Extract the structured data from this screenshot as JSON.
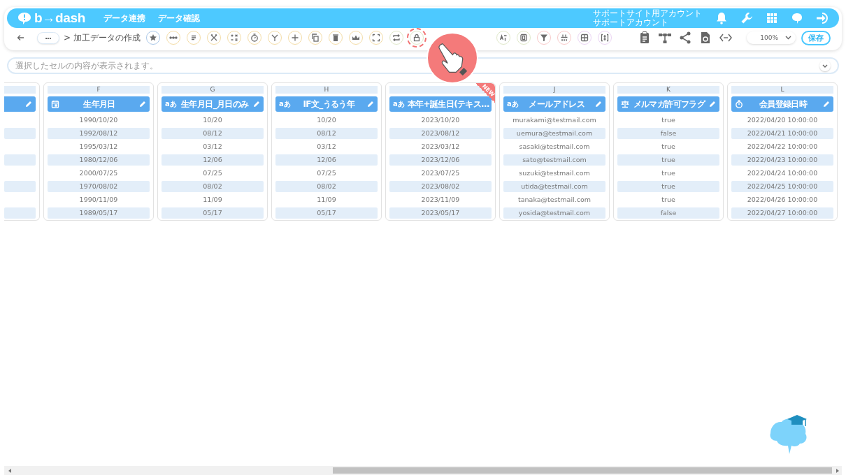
{
  "header": {
    "logo": "b→dash",
    "nav": [
      {
        "label": "データ連携"
      },
      {
        "label": "データ確認"
      }
    ],
    "account": {
      "site": "サポートサイト用アカウント",
      "name": "サポートアカウント"
    },
    "icons": [
      {
        "kind": "bell"
      },
      {
        "kind": "wrench"
      },
      {
        "kind": "apps"
      },
      {
        "kind": "assistant"
      },
      {
        "kind": "logout"
      }
    ]
  },
  "toolbar": {
    "more": "•••",
    "breadcrumb": "> 加工データの作成",
    "tool_groups": [
      [
        {
          "kind": "star",
          "color": "#a9c7e8",
          "highlighted": false
        },
        {
          "kind": "dots",
          "color": "#f3dca6",
          "highlighted": false
        },
        {
          "kind": "lines",
          "color": "#f3dca6",
          "highlighted": false
        },
        {
          "kind": "scissors",
          "color": "#f3dca6",
          "highlighted": false
        },
        {
          "kind": "math",
          "color": "#f3dca6",
          "highlighted": false
        },
        {
          "kind": "timer",
          "color": "#f3dca6",
          "highlighted": false
        },
        {
          "kind": "branch",
          "color": "#f3dca6",
          "highlighted": false
        },
        {
          "kind": "plus",
          "color": "#f3dca6",
          "highlighted": false
        },
        {
          "kind": "copy",
          "color": "#f3dca6",
          "highlighted": false
        },
        {
          "kind": "trash",
          "color": "#f3dca6",
          "highlighted": false
        },
        {
          "kind": "crown",
          "color": "#f3dca6",
          "highlighted": false
        },
        {
          "kind": "expand",
          "color": "#f3dca6",
          "highlighted": false
        },
        {
          "kind": "swap",
          "color": "#dfe8c9",
          "highlighted": false
        },
        {
          "kind": "lock",
          "color": "#dfe8c9",
          "highlighted": true
        }
      ],
      [
        {
          "kind": "translate",
          "color": "#dfe8c9",
          "highlighted": false
        },
        {
          "kind": "zero",
          "color": "#dfe8c9",
          "highlighted": false
        },
        {
          "kind": "filter",
          "color": "#f8c9c9",
          "highlighted": false
        },
        {
          "kind": "group",
          "color": "#f8c9c9",
          "highlighted": false
        },
        {
          "kind": "grid",
          "color": "#ead3f3",
          "highlighted": false
        },
        {
          "kind": "bracket",
          "color": "#ead3f3",
          "highlighted": false
        }
      ]
    ],
    "actions": [
      {
        "kind": "clipboard"
      },
      {
        "kind": "hierarchy"
      },
      {
        "kind": "share"
      },
      {
        "kind": "restore"
      },
      {
        "kind": "code"
      }
    ],
    "zoom": "100%",
    "save": "保存"
  },
  "formula_bar": {
    "placeholder": "選択したセルの内容が表示されます。"
  },
  "columns": [
    {
      "kind": "partial"
    },
    {
      "kind": "date",
      "letter": "F",
      "title": "生年月日",
      "cells": [
        "1990/10/20",
        "1992/08/12",
        "1995/03/12",
        "1980/12/06",
        "2000/07/25",
        "1970/08/02",
        "1990/11/09",
        "1989/05/17"
      ]
    },
    {
      "kind": "text",
      "letter": "G",
      "type_badge": "aあ",
      "title": "生年月日_月日のみ",
      "cells": [
        "10/20",
        "08/12",
        "03/12",
        "12/06",
        "07/25",
        "08/02",
        "11/09",
        "05/17"
      ]
    },
    {
      "kind": "text",
      "letter": "H",
      "type_badge": "aあ",
      "title": "IF文_うるう年",
      "cells": [
        "10/20",
        "08/12",
        "03/12",
        "12/06",
        "07/25",
        "08/02",
        "11/09",
        "05/17"
      ]
    },
    {
      "kind": "text",
      "type_badge": "aあ",
      "title": "本年+誕生日(テキス…",
      "new": true,
      "new_label": "NEW",
      "cells": [
        "2023/10/20",
        "2023/08/12",
        "2023/03/12",
        "2023/12/06",
        "2023/07/25",
        "2023/08/02",
        "2023/11/09",
        "2023/05/17"
      ]
    },
    {
      "kind": "text",
      "letter": "J",
      "type_badge": "aあ",
      "title": "メールアドレス",
      "cells": [
        "murakami@testmail.com",
        "uemura@testmail.com",
        "sasaki@testmail.com",
        "sato@testmail.com",
        "suzuki@testmail.com",
        "utida@testmail.com",
        "tanaka@testmail.com",
        "yosida@testmail.com"
      ]
    },
    {
      "kind": "boolean",
      "letter": "K",
      "title": "メルマガ許可フラグ",
      "cells": [
        "true",
        "false",
        "true",
        "true",
        "true",
        "true",
        "true",
        "false"
      ]
    },
    {
      "kind": "datetime",
      "letter": "L",
      "title": "会員登録日時",
      "cells": [
        "2022/04/20 10:00:00",
        "2022/04/21 10:00:00",
        "2022/04/22 10:00:00",
        "2022/04/23 10:00:00",
        "2022/04/24 10:00:00",
        "2022/04/25 10:00:00",
        "2022/04/26 10:00:00",
        "2022/04/27 10:00:00"
      ]
    }
  ]
}
